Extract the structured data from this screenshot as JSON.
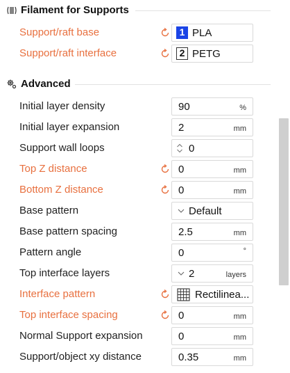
{
  "sections": {
    "filament": {
      "title": "Filament for Supports",
      "icon": "filament-icon"
    },
    "advanced": {
      "title": "Advanced",
      "icon": "advanced-settings-icon"
    }
  },
  "filament_rows": [
    {
      "label": "Support/raft base",
      "badge": "1",
      "value": "PLA",
      "modified": true
    },
    {
      "label": "Support/raft interface",
      "badge": "2",
      "value": "PETG",
      "modified": true
    }
  ],
  "advanced_rows": [
    {
      "label": "Initial layer density",
      "value": "90",
      "unit": "%",
      "modified": false
    },
    {
      "label": "Initial layer expansion",
      "value": "2",
      "unit": "mm",
      "modified": false
    },
    {
      "label": "Support wall loops",
      "value": "0",
      "unit": "",
      "modified": false
    },
    {
      "label": "Top Z distance",
      "value": "0",
      "unit": "mm",
      "modified": true
    },
    {
      "label": "Bottom Z distance",
      "value": "0",
      "unit": "mm",
      "modified": true
    },
    {
      "label": "Base pattern",
      "value": "Default",
      "unit": "",
      "modified": false
    },
    {
      "label": "Base pattern spacing",
      "value": "2.5",
      "unit": "mm",
      "modified": false
    },
    {
      "label": "Pattern angle",
      "value": "0",
      "unit": "°",
      "modified": false
    },
    {
      "label": "Top interface layers",
      "value": "2",
      "unit": "layers",
      "modified": false
    },
    {
      "label": "Interface pattern",
      "value": "Rectilinea...",
      "unit": "",
      "modified": true
    },
    {
      "label": "Top interface spacing",
      "value": "0",
      "unit": "mm",
      "modified": true
    },
    {
      "label": "Normal Support expansion",
      "value": "0",
      "unit": "mm",
      "modified": false
    },
    {
      "label": "Support/object xy distance",
      "value": "0.35",
      "unit": "mm",
      "modified": false
    }
  ],
  "colors": {
    "modified_label": "#e8703f",
    "badge_blue": "#1a44e6"
  }
}
